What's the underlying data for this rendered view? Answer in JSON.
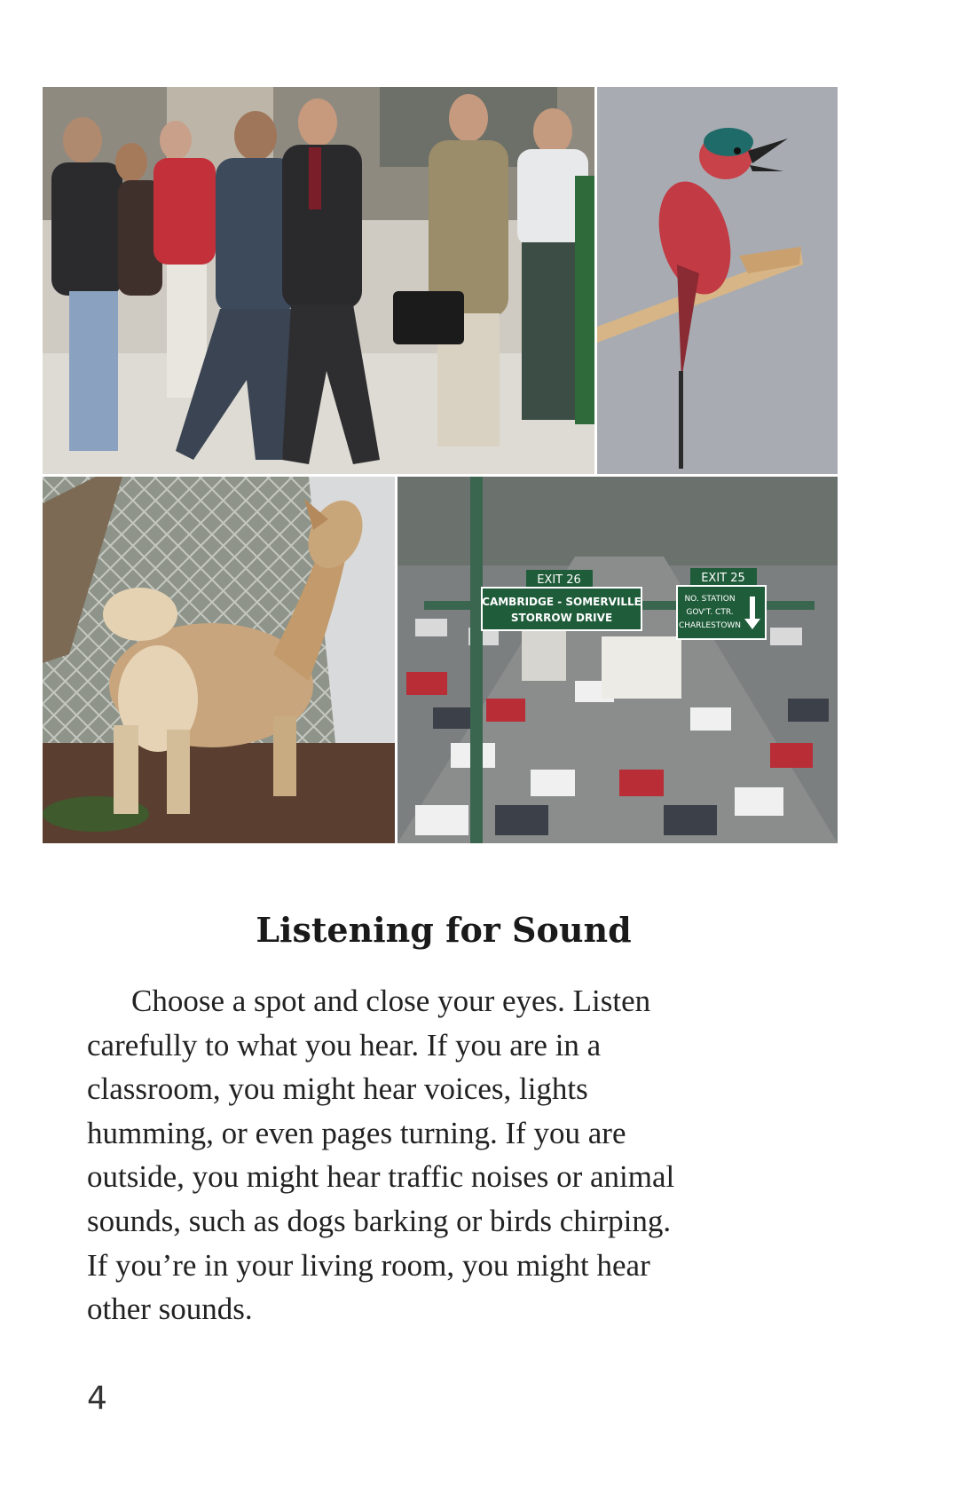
{
  "heading": "Listening for Sound",
  "paragraph_lines": [
    "Choose a spot and close your eyes. Listen",
    "carefully to what you hear. If you are in a",
    "classroom, you might hear voices, lights",
    "humming, or even pages turning. If you are",
    "outside, you might hear traffic noises or animal",
    "sounds, such as dogs barking or birds chirping.",
    "If you’re in your living room, you might hear",
    "other sounds."
  ],
  "page_number": "4",
  "traffic_signs": {
    "exit_left": "EXIT 26",
    "left_line1": "CAMBRIDGE - SOMERVILLE",
    "left_line2": "STORROW DRIVE",
    "exit_right": "EXIT 25",
    "right_line1": "NO. STATION",
    "right_line2": "GOV'T. CTR.",
    "right_line3": "CHARLESTOWN"
  },
  "colors": {
    "sign_green": "#1f5c3a",
    "bird_red": "#c23a44",
    "page_bg": "#ffffff"
  }
}
